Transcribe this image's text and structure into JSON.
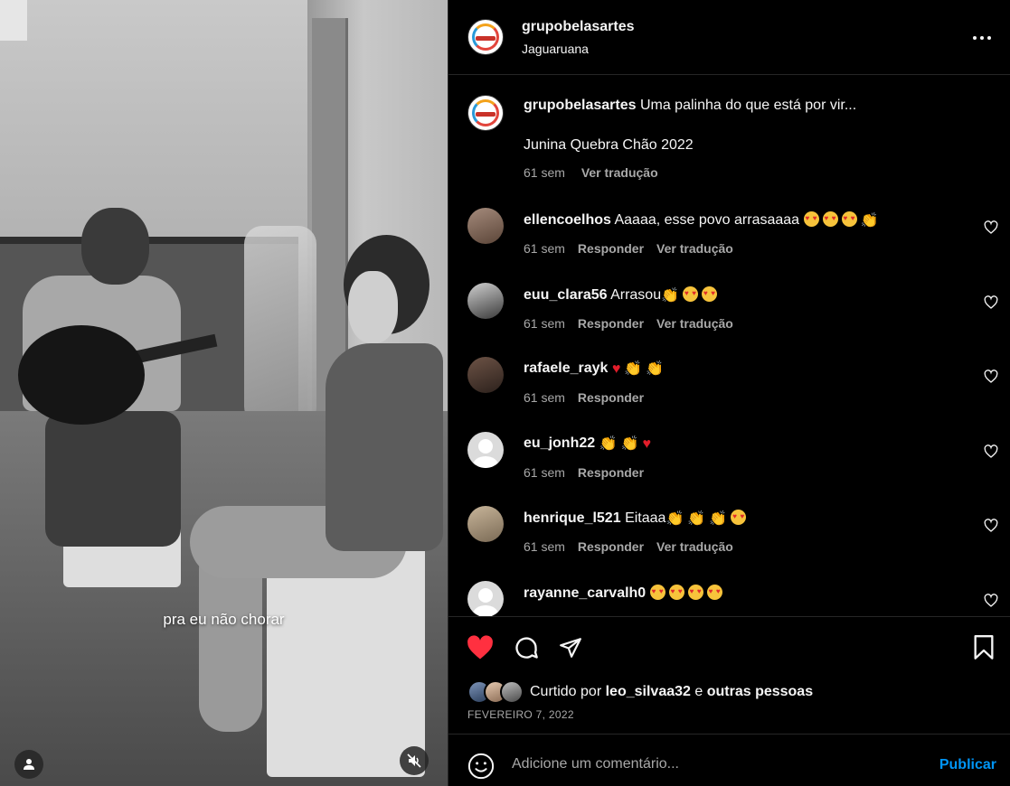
{
  "video": {
    "subtitle": "pra eu não chorar",
    "tags_icon": "user-tag-icon",
    "mute_icon": "volume-muted-icon"
  },
  "header": {
    "username": "grupobelasartes",
    "location": "Jaguaruana",
    "more_icon": "more-dots-icon"
  },
  "caption": {
    "username": "grupobelasartes",
    "text": "Uma palinha do que está por vir...",
    "line2": "Junina Quebra Chão 2022",
    "time": "61 sem",
    "translate": "Ver tradução"
  },
  "comments": [
    {
      "username": "ellencoelhos",
      "text": "Aaaaa, esse povo arrasaaaa",
      "emojis": [
        "heart-eyes",
        "heart-eyes",
        "heart-eyes",
        "clap"
      ],
      "time": "61 sem",
      "reply": "Responder",
      "translate": "Ver tradução"
    },
    {
      "username": "euu_clara56",
      "text": "Arrasou",
      "emojis": [
        "clap",
        "heart-eyes",
        "heart-eyes"
      ],
      "time": "61 sem",
      "reply": "Responder",
      "translate": "Ver tradução"
    },
    {
      "username": "rafaele_rayk",
      "text": "",
      "emojis": [
        "red-heart",
        "clap",
        "clap"
      ],
      "time": "61 sem",
      "reply": "Responder",
      "translate": ""
    },
    {
      "username": "eu_jonh22",
      "text": "",
      "emojis": [
        "clap",
        "clap",
        "red-heart"
      ],
      "time": "61 sem",
      "reply": "Responder",
      "translate": ""
    },
    {
      "username": "henrique_l521",
      "text": "Eitaaa",
      "emojis": [
        "clap",
        "clap",
        "clap",
        "heart-eyes"
      ],
      "time": "61 sem",
      "reply": "Responder",
      "translate": "Ver tradução"
    },
    {
      "username": "rayanne_carvalh0",
      "text": "",
      "emojis": [
        "heart-eyes",
        "heart-eyes",
        "heart-eyes",
        "heart-eyes"
      ],
      "time": "",
      "reply": "",
      "translate": ""
    }
  ],
  "actions": {
    "like_icon": "heart-filled-icon",
    "comment_icon": "comment-bubble-icon",
    "share_icon": "paper-plane-icon",
    "save_icon": "bookmark-icon",
    "liked_prefix": "Curtido por",
    "liked_user": "leo_silvaa32",
    "liked_joiner": "e",
    "liked_others": "outras pessoas",
    "date": "FEVEREIRO 7, 2022"
  },
  "composer": {
    "placeholder": "Adicione um comentário...",
    "publish": "Publicar",
    "emoji_icon": "smiley-icon"
  },
  "colors": {
    "background": "#000000",
    "text": "#f5f5f5",
    "secondary": "#a8a8a8",
    "like": "#ff3040",
    "link": "#0095f6"
  }
}
